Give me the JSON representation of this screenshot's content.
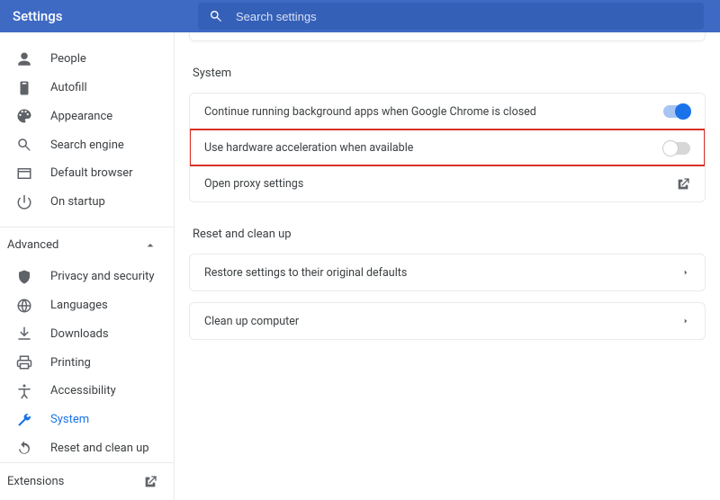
{
  "header": {
    "title": "Settings",
    "search_placeholder": "Search settings"
  },
  "sidebar": {
    "items": [
      {
        "label": "People"
      },
      {
        "label": "Autofill"
      },
      {
        "label": "Appearance"
      },
      {
        "label": "Search engine"
      },
      {
        "label": "Default browser"
      },
      {
        "label": "On startup"
      }
    ],
    "advanced_label": "Advanced",
    "advanced_items": [
      {
        "label": "Privacy and security"
      },
      {
        "label": "Languages"
      },
      {
        "label": "Downloads"
      },
      {
        "label": "Printing"
      },
      {
        "label": "Accessibility"
      },
      {
        "label": "System"
      },
      {
        "label": "Reset and clean up"
      }
    ],
    "extensions_label": "Extensions"
  },
  "content": {
    "system": {
      "title": "System",
      "rows": {
        "bg_apps": "Continue running background apps when Google Chrome is closed",
        "hw_accel": "Use hardware acceleration when available",
        "proxy": "Open proxy settings"
      }
    },
    "reset": {
      "title": "Reset and clean up",
      "rows": {
        "restore": "Restore settings to their original defaults",
        "cleanup": "Clean up computer"
      }
    }
  }
}
